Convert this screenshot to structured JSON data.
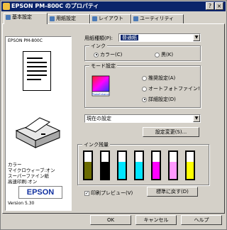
{
  "window": {
    "title": "EPSON PM-800C のプロパティ",
    "help_label": "?",
    "close_label": "×"
  },
  "tabs": [
    "基本設定",
    "用紙設定",
    "レイアウト",
    "ユーティリティ"
  ],
  "preview": {
    "printer_name": "EPSON PM-800C",
    "info_lines": [
      "カラー",
      "マイクロウィーブ:オン",
      "スーパーファイン紙",
      "高速印刷:オン"
    ],
    "brand": "EPSON",
    "version": "Version 5.30"
  },
  "paper_type": {
    "label": "用紙種類(P):",
    "value": "普通紙"
  },
  "ink_group": {
    "title": "インク",
    "options": [
      "カラー(C)",
      "黒(K)"
    ],
    "selected": 0
  },
  "mode_group": {
    "title": "モード設定",
    "options": [
      "推奨設定(A)",
      "オートフォトファイン!",
      "詳細設定(D)"
    ],
    "selected": 2,
    "badge": "PhotoEnhance"
  },
  "detail_select": {
    "value": "現在の設定"
  },
  "setting_button": "設定変更(S)...",
  "ink_level": {
    "title": "インク残量",
    "cartridges": [
      {
        "color": "#6b6b00",
        "level": 0.62
      },
      {
        "color": "#000000",
        "level": 0.62
      },
      {
        "color": "#00e5ff",
        "level": 0.62
      },
      {
        "color": "#00e5ff",
        "level": 0.62
      },
      {
        "color": "#ff00ff",
        "level": 0.62
      },
      {
        "color": "#ff99ff",
        "level": 0.62
      },
      {
        "color": "#ffff00",
        "level": 0.62
      }
    ]
  },
  "preview_check": {
    "label": "印刷プレビュー(V)",
    "checked": true
  },
  "restore_button": "標準に戻す(D)",
  "footer": {
    "ok": "OK",
    "cancel": "キャンセル",
    "help": "ヘルプ"
  }
}
